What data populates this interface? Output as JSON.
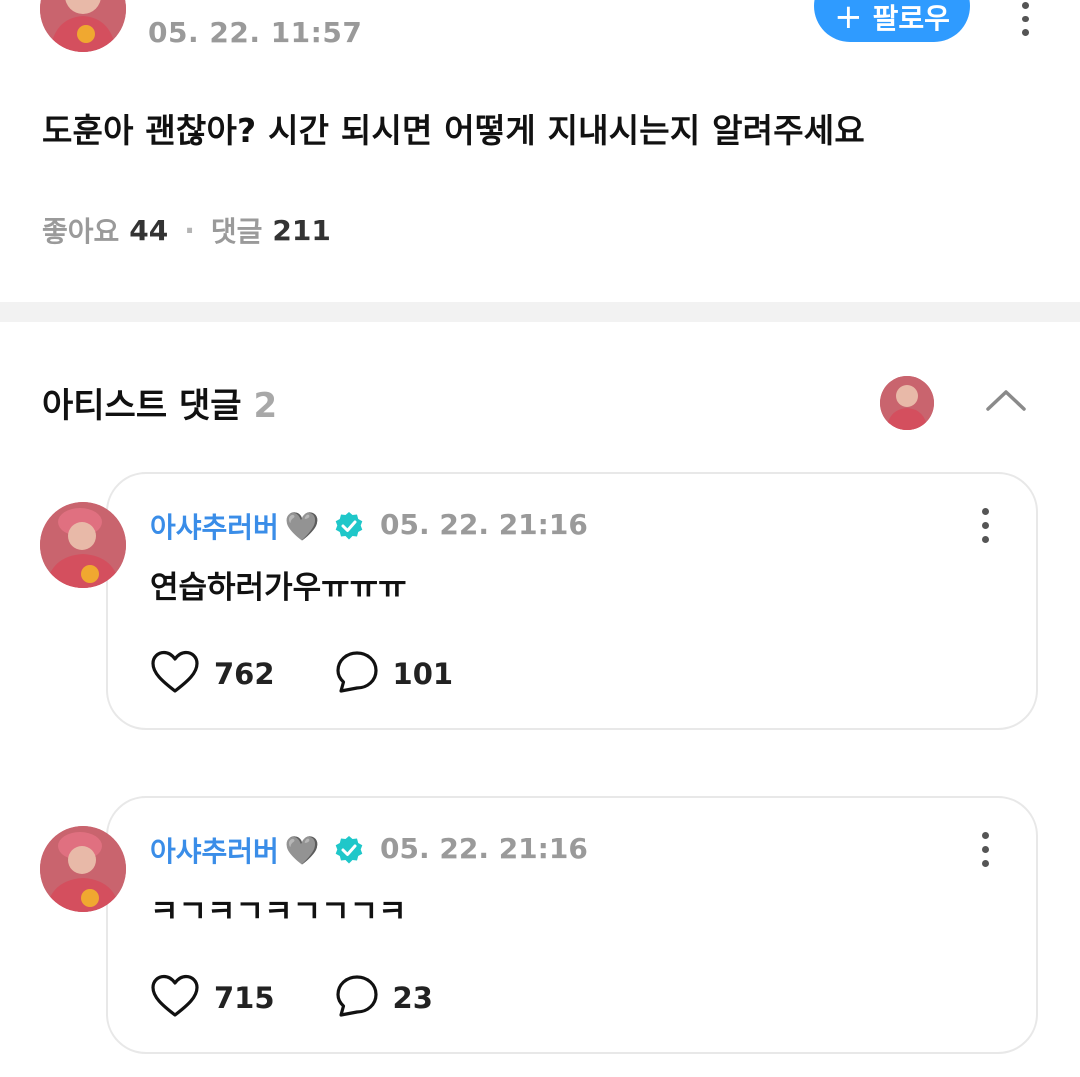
{
  "post": {
    "author": "",
    "time": "05. 22. 11:57",
    "follow_label": "팔로우",
    "follow_plus": "+",
    "body": "도훈아 괜찮아? 시간 되시면 어떻게 지내시는지 알려주세요",
    "likes_label": "좋아요",
    "likes_count": "44",
    "separator": "·",
    "comments_label": "댓글",
    "comments_count": "211"
  },
  "artist_section": {
    "title": "아티스트 댓글",
    "count": "2"
  },
  "comments": [
    {
      "name": "아샤추러버",
      "name_emoji": "🩶",
      "time": "05. 22. 21:16",
      "text": "연습하러가우ㅠㅠㅠ",
      "likes": "762",
      "replies": "101"
    },
    {
      "name": "아샤추러버",
      "name_emoji": "🩶",
      "time": "05. 22. 21:16",
      "text": "ㅋㄱㅋㄱㅋㄱㄱㄱㅋ",
      "likes": "715",
      "replies": "23"
    }
  ],
  "colors": {
    "accent_blue": "#2f9bff",
    "name_blue": "#3a8de8",
    "verified_teal": "#1fc7c9",
    "muted_gray": "#9a9a9a",
    "divider": "#f2f2f2"
  },
  "icons": {
    "like": "heart-outline-icon",
    "reply": "speech-bubble-icon",
    "more": "vertical-dots-icon",
    "collapse": "chevron-up-icon",
    "verified": "verified-badge-icon"
  }
}
